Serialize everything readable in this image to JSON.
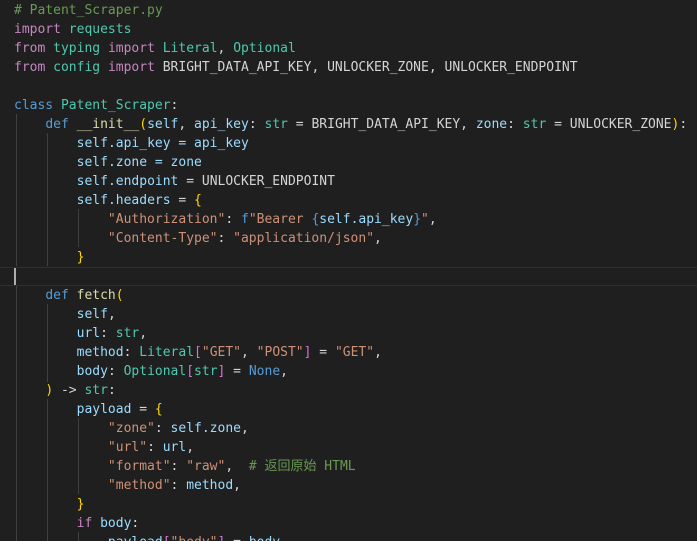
{
  "editor": {
    "lines": [
      [
        {
          "t": "# Patent_Scraper.py",
          "c": "comment"
        }
      ],
      [
        {
          "t": "import",
          "c": "control"
        },
        {
          "t": " requests",
          "c": "class"
        }
      ],
      [
        {
          "t": "from",
          "c": "control"
        },
        {
          "t": " typing ",
          "c": "class"
        },
        {
          "t": "import",
          "c": "control"
        },
        {
          "t": " Literal",
          "c": "class"
        },
        {
          "t": ", ",
          "c": "plain"
        },
        {
          "t": "Optional",
          "c": "class"
        }
      ],
      [
        {
          "t": "from",
          "c": "control"
        },
        {
          "t": " config ",
          "c": "class"
        },
        {
          "t": "import",
          "c": "control"
        },
        {
          "t": " BRIGHT_DATA_API_KEY, UNLOCKER_ZONE, UNLOCKER_ENDPOINT",
          "c": "plain"
        }
      ],
      [],
      [
        {
          "t": "class",
          "c": "keyword"
        },
        {
          "t": " ",
          "c": "plain"
        },
        {
          "t": "Patent_Scraper",
          "c": "class"
        },
        {
          "t": ":",
          "c": "plain"
        }
      ],
      [
        {
          "t": "    ",
          "c": "plain"
        },
        {
          "t": "def",
          "c": "keyword"
        },
        {
          "t": " ",
          "c": "plain"
        },
        {
          "t": "__init__",
          "c": "func"
        },
        {
          "t": "(",
          "c": "bracket1"
        },
        {
          "t": "self",
          "c": "self"
        },
        {
          "t": ", ",
          "c": "plain"
        },
        {
          "t": "api_key",
          "c": "var"
        },
        {
          "t": ": ",
          "c": "plain"
        },
        {
          "t": "str",
          "c": "builtin"
        },
        {
          "t": " = BRIGHT_DATA_API_KEY, ",
          "c": "plain"
        },
        {
          "t": "zone",
          "c": "var"
        },
        {
          "t": ": ",
          "c": "plain"
        },
        {
          "t": "str",
          "c": "builtin"
        },
        {
          "t": " = UNLOCKER_ZONE",
          "c": "plain"
        },
        {
          "t": ")",
          "c": "bracket1"
        },
        {
          "t": ":",
          "c": "plain"
        }
      ],
      [
        {
          "t": "        ",
          "c": "plain"
        },
        {
          "t": "self",
          "c": "self"
        },
        {
          "t": ".api_key = api_key",
          "c": "var"
        }
      ],
      [
        {
          "t": "        ",
          "c": "plain"
        },
        {
          "t": "self",
          "c": "self"
        },
        {
          "t": ".zone = zone",
          "c": "var"
        }
      ],
      [
        {
          "t": "        ",
          "c": "plain"
        },
        {
          "t": "self",
          "c": "self"
        },
        {
          "t": ".endpoint",
          "c": "var"
        },
        {
          "t": " = UNLOCKER_ENDPOINT",
          "c": "plain"
        }
      ],
      [
        {
          "t": "        ",
          "c": "plain"
        },
        {
          "t": "self",
          "c": "self"
        },
        {
          "t": ".headers",
          "c": "var"
        },
        {
          "t": " = ",
          "c": "plain"
        },
        {
          "t": "{",
          "c": "bracket1"
        }
      ],
      [
        {
          "t": "            ",
          "c": "plain"
        },
        {
          "t": "\"Authorization\"",
          "c": "string"
        },
        {
          "t": ": ",
          "c": "plain"
        },
        {
          "t": "f",
          "c": "keyword"
        },
        {
          "t": "\"Bearer ",
          "c": "string"
        },
        {
          "t": "{",
          "c": "keyword"
        },
        {
          "t": "self",
          "c": "self"
        },
        {
          "t": ".api_key",
          "c": "var"
        },
        {
          "t": "}",
          "c": "keyword"
        },
        {
          "t": "\"",
          "c": "string"
        },
        {
          "t": ",",
          "c": "plain"
        }
      ],
      [
        {
          "t": "            ",
          "c": "plain"
        },
        {
          "t": "\"Content-Type\"",
          "c": "string"
        },
        {
          "t": ": ",
          "c": "plain"
        },
        {
          "t": "\"application/json\"",
          "c": "string"
        },
        {
          "t": ",",
          "c": "plain"
        }
      ],
      [
        {
          "t": "        ",
          "c": "plain"
        },
        {
          "t": "}",
          "c": "bracket1"
        }
      ],
      [],
      [
        {
          "t": "    ",
          "c": "plain"
        },
        {
          "t": "def",
          "c": "keyword"
        },
        {
          "t": " ",
          "c": "plain"
        },
        {
          "t": "fetch",
          "c": "func"
        },
        {
          "t": "(",
          "c": "bracket1"
        }
      ],
      [
        {
          "t": "        ",
          "c": "plain"
        },
        {
          "t": "self",
          "c": "self"
        },
        {
          "t": ",",
          "c": "plain"
        }
      ],
      [
        {
          "t": "        ",
          "c": "plain"
        },
        {
          "t": "url",
          "c": "var"
        },
        {
          "t": ": ",
          "c": "plain"
        },
        {
          "t": "str",
          "c": "builtin"
        },
        {
          "t": ",",
          "c": "plain"
        }
      ],
      [
        {
          "t": "        ",
          "c": "plain"
        },
        {
          "t": "method",
          "c": "var"
        },
        {
          "t": ": ",
          "c": "plain"
        },
        {
          "t": "Literal",
          "c": "class"
        },
        {
          "t": "[",
          "c": "bracket2"
        },
        {
          "t": "\"GET\"",
          "c": "string"
        },
        {
          "t": ", ",
          "c": "plain"
        },
        {
          "t": "\"POST\"",
          "c": "string"
        },
        {
          "t": "]",
          "c": "bracket2"
        },
        {
          "t": " = ",
          "c": "plain"
        },
        {
          "t": "\"GET\"",
          "c": "string"
        },
        {
          "t": ",",
          "c": "plain"
        }
      ],
      [
        {
          "t": "        ",
          "c": "plain"
        },
        {
          "t": "body",
          "c": "var"
        },
        {
          "t": ": ",
          "c": "plain"
        },
        {
          "t": "Optional",
          "c": "class"
        },
        {
          "t": "[",
          "c": "bracket2"
        },
        {
          "t": "str",
          "c": "builtin"
        },
        {
          "t": "]",
          "c": "bracket2"
        },
        {
          "t": " = ",
          "c": "plain"
        },
        {
          "t": "None",
          "c": "keyword"
        },
        {
          "t": ",",
          "c": "plain"
        }
      ],
      [
        {
          "t": "    ",
          "c": "plain"
        },
        {
          "t": ")",
          "c": "bracket1"
        },
        {
          "t": " -> ",
          "c": "plain"
        },
        {
          "t": "str",
          "c": "builtin"
        },
        {
          "t": ":",
          "c": "plain"
        }
      ],
      [
        {
          "t": "        ",
          "c": "plain"
        },
        {
          "t": "payload",
          "c": "var"
        },
        {
          "t": " = ",
          "c": "plain"
        },
        {
          "t": "{",
          "c": "bracket1"
        }
      ],
      [
        {
          "t": "            ",
          "c": "plain"
        },
        {
          "t": "\"zone\"",
          "c": "string"
        },
        {
          "t": ": ",
          "c": "plain"
        },
        {
          "t": "self",
          "c": "self"
        },
        {
          "t": ".zone",
          "c": "var"
        },
        {
          "t": ",",
          "c": "plain"
        }
      ],
      [
        {
          "t": "            ",
          "c": "plain"
        },
        {
          "t": "\"url\"",
          "c": "string"
        },
        {
          "t": ": ",
          "c": "plain"
        },
        {
          "t": "url",
          "c": "var"
        },
        {
          "t": ",",
          "c": "plain"
        }
      ],
      [
        {
          "t": "            ",
          "c": "plain"
        },
        {
          "t": "\"format\"",
          "c": "string"
        },
        {
          "t": ": ",
          "c": "plain"
        },
        {
          "t": "\"raw\"",
          "c": "string"
        },
        {
          "t": ",  ",
          "c": "plain"
        },
        {
          "t": "# 返回原始 HTML",
          "c": "comment"
        }
      ],
      [
        {
          "t": "            ",
          "c": "plain"
        },
        {
          "t": "\"method\"",
          "c": "string"
        },
        {
          "t": ": ",
          "c": "plain"
        },
        {
          "t": "method",
          "c": "var"
        },
        {
          "t": ",",
          "c": "plain"
        }
      ],
      [
        {
          "t": "        ",
          "c": "plain"
        },
        {
          "t": "}",
          "c": "bracket1"
        }
      ],
      [
        {
          "t": "        ",
          "c": "plain"
        },
        {
          "t": "if",
          "c": "control"
        },
        {
          "t": " ",
          "c": "plain"
        },
        {
          "t": "body",
          "c": "var"
        },
        {
          "t": ":",
          "c": "plain"
        }
      ],
      [
        {
          "t": "            ",
          "c": "plain"
        },
        {
          "t": "payload",
          "c": "var"
        },
        {
          "t": "[",
          "c": "bracket2"
        },
        {
          "t": "\"body\"",
          "c": "string"
        },
        {
          "t": "]",
          "c": "bracket2"
        },
        {
          "t": " = ",
          "c": "plain"
        },
        {
          "t": "body",
          "c": "var"
        }
      ]
    ],
    "current_line": 14
  }
}
